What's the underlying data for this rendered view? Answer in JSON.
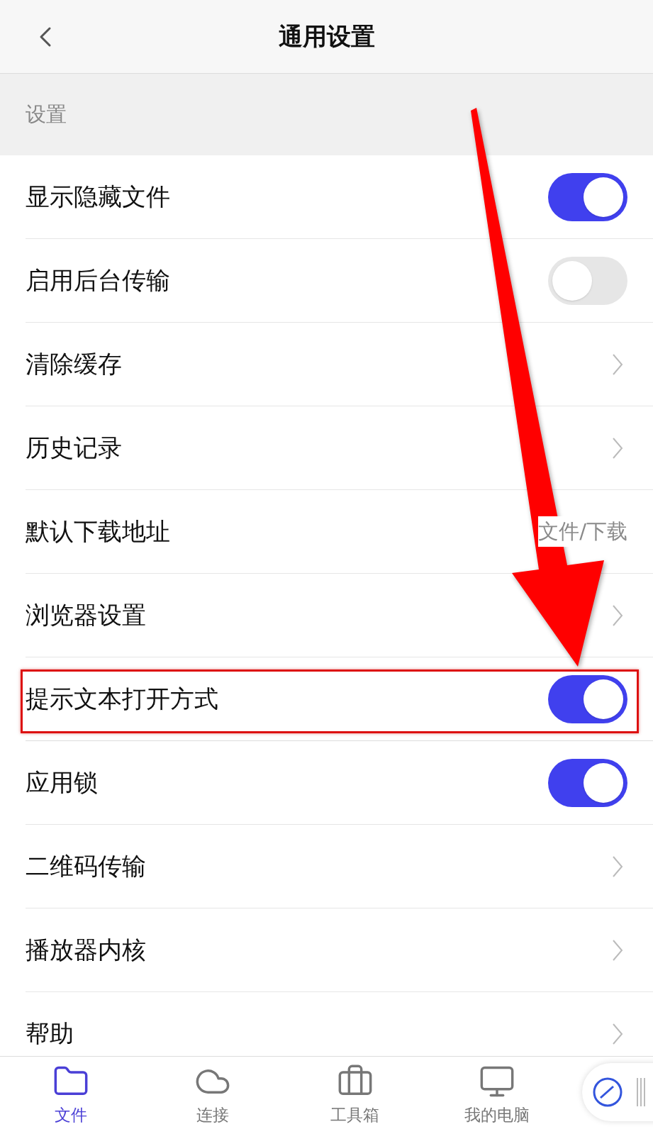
{
  "header": {
    "title": "通用设置"
  },
  "section": {
    "label": "设置"
  },
  "rows": [
    {
      "kind": "toggle",
      "label": "显示隐藏文件",
      "on": true,
      "highlighted": false
    },
    {
      "kind": "toggle",
      "label": "启用后台传输",
      "on": false,
      "highlighted": false
    },
    {
      "kind": "link",
      "label": "清除缓存",
      "highlighted": false
    },
    {
      "kind": "link",
      "label": "历史记录",
      "highlighted": false
    },
    {
      "kind": "value",
      "label": "默认下载地址",
      "value": "文件/下载",
      "highlighted": false
    },
    {
      "kind": "link",
      "label": "浏览器设置",
      "highlighted": false
    },
    {
      "kind": "toggle",
      "label": "提示文本打开方式",
      "on": true,
      "highlighted": true
    },
    {
      "kind": "toggle",
      "label": "应用锁",
      "on": true,
      "highlighted": false
    },
    {
      "kind": "link",
      "label": "二维码传输",
      "highlighted": false
    },
    {
      "kind": "link",
      "label": "播放器内核",
      "highlighted": false
    },
    {
      "kind": "link",
      "label": "帮助",
      "highlighted": false
    }
  ],
  "tabs": [
    {
      "label": "文件",
      "selected": true
    },
    {
      "label": "连接",
      "selected": false
    },
    {
      "label": "工具箱",
      "selected": false
    },
    {
      "label": "我的电脑",
      "selected": false
    }
  ]
}
